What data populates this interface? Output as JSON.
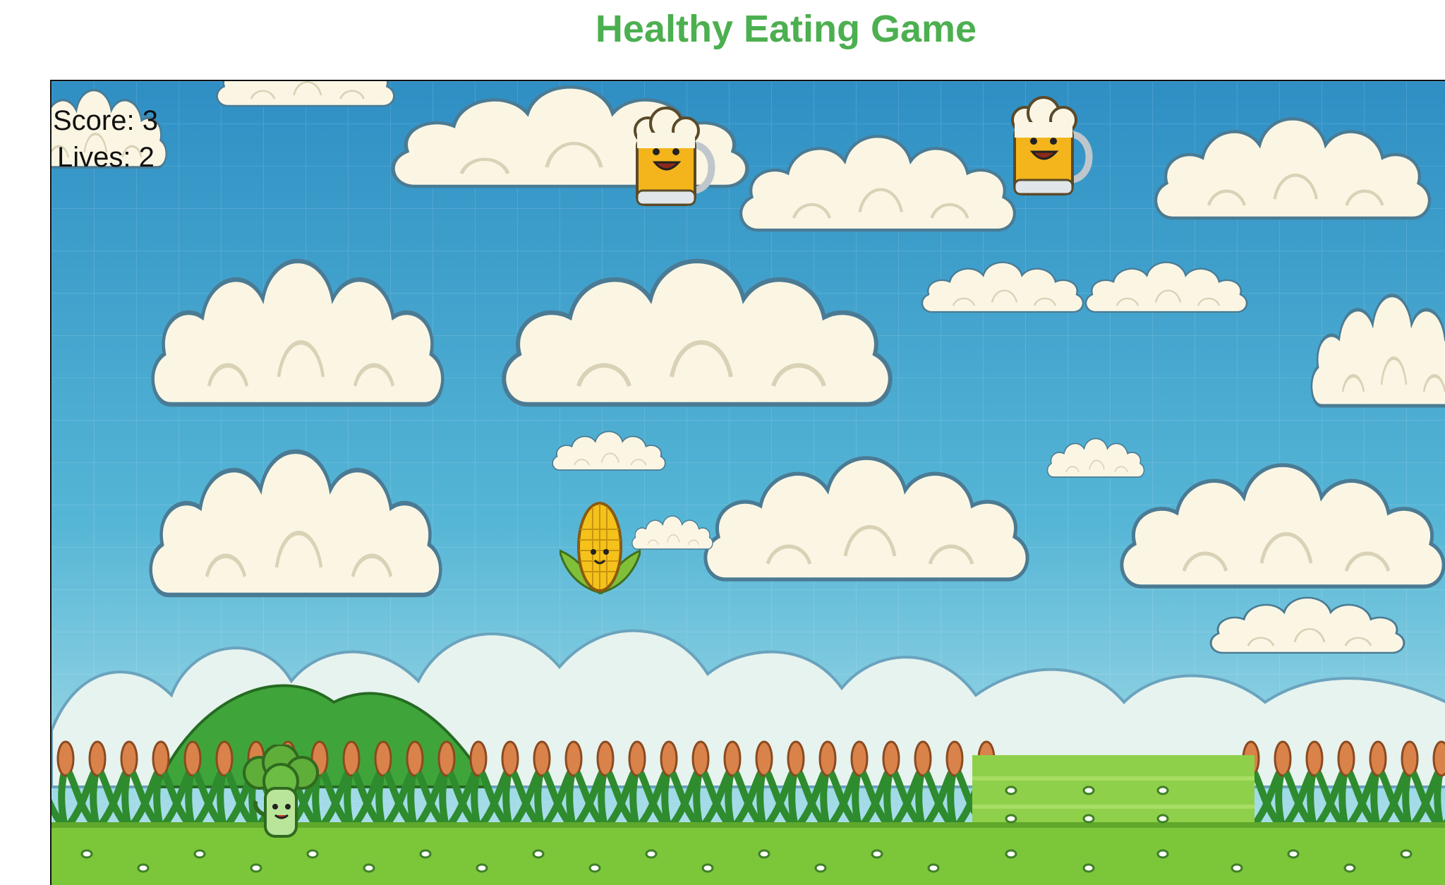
{
  "title": "Healthy Eating Game",
  "hud": {
    "score_label": "Score:",
    "score_value": "3",
    "lives_label": "Lives:",
    "lives_value": "2"
  },
  "sprites": {
    "player": "broccoli-player-icon",
    "falling": [
      "beer-mug-icon",
      "beer-mug-icon",
      "corn-icon"
    ]
  },
  "colors": {
    "title": "#4caf50",
    "sky_top": "#2f8fc4",
    "sky_bottom": "#a8dde8",
    "grass": "#7cc63a"
  }
}
